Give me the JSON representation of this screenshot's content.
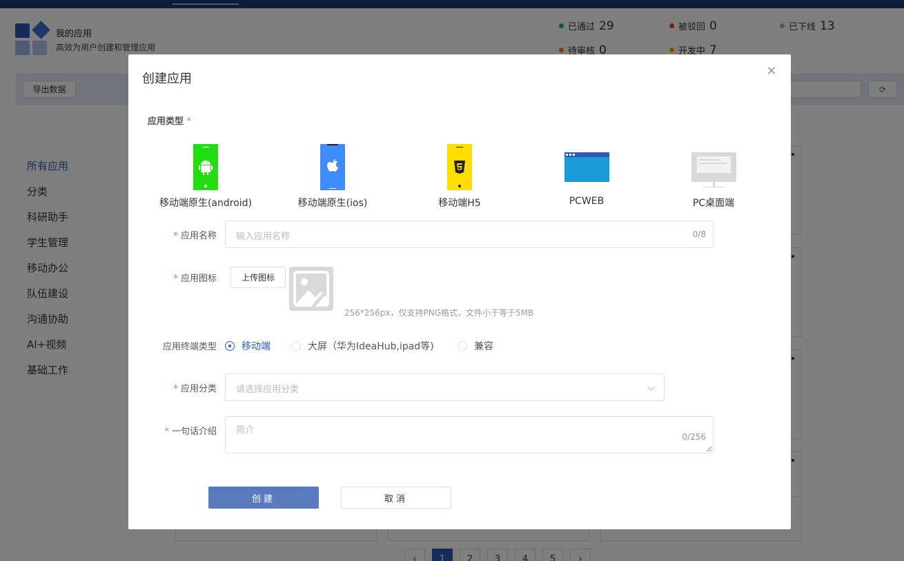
{
  "header": {
    "app_title": "我的应用",
    "app_subtitle": "高效为用户创建和管理应用",
    "stats": [
      {
        "label": "已通过",
        "count": "29",
        "color": "#19be6b"
      },
      {
        "label": "被驳回",
        "count": "0",
        "color": "#ed4014"
      },
      {
        "label": "已下线",
        "count": "13",
        "color": "#aaaaaa"
      },
      {
        "label": "待审核",
        "count": "0",
        "color": "#ff7a2f"
      },
      {
        "label": "开发中",
        "count": "7",
        "color": "#ff9900"
      }
    ]
  },
  "toolbar": {
    "export_label": "导出数据"
  },
  "sidebar": {
    "items": [
      {
        "label": "所有应用"
      },
      {
        "label": "分类"
      },
      {
        "label": "科研助手"
      },
      {
        "label": "学生管理"
      },
      {
        "label": "移动办公"
      },
      {
        "label": "队伍建设"
      },
      {
        "label": "沟通协助"
      },
      {
        "label": "AI+视频"
      },
      {
        "label": "基础工作"
      }
    ]
  },
  "pagination": {
    "pages": [
      "1",
      "2",
      "3",
      "4",
      "5"
    ],
    "current": "1"
  },
  "modal": {
    "title": "创建应用",
    "close_icon": "close-icon",
    "type_label": "应用类型",
    "types": [
      {
        "label": "移动端原生(android)",
        "icon": "android-icon",
        "color": "#22dd11"
      },
      {
        "label": "移动端原生(ios)",
        "icon": "apple-icon",
        "color": "#3f8cff"
      },
      {
        "label": "移动端H5",
        "icon": "html5-icon",
        "color": "#ffdd00"
      },
      {
        "label": "PCWEB",
        "icon": "browser-window-icon",
        "color": "#1a9bd7"
      },
      {
        "label": "PC桌面端",
        "icon": "desktop-monitor-icon",
        "color": "#d9d9d9"
      }
    ],
    "name_label": "应用名称",
    "name_placeholder": "输入应用名称",
    "name_count": "0/8",
    "icon_label": "应用图标",
    "upload_label": "上传图标",
    "icon_hint": "256*256px，仅支持PNG格式，文件小于等于5MB",
    "terminal_label": "应用终端类型",
    "terminal_options": [
      {
        "label": "移动端",
        "checked": true
      },
      {
        "label": "大屏（华为IdeaHub,ipad等)",
        "checked": false
      },
      {
        "label": "兼容",
        "checked": false
      }
    ],
    "category_label": "应用分类",
    "category_placeholder": "请选择应用分类",
    "intro_label": "一句话介绍",
    "intro_placeholder": "简介",
    "intro_count": "0/256",
    "create_label": "创建",
    "cancel_label": "取消",
    "required_mark": "*"
  }
}
